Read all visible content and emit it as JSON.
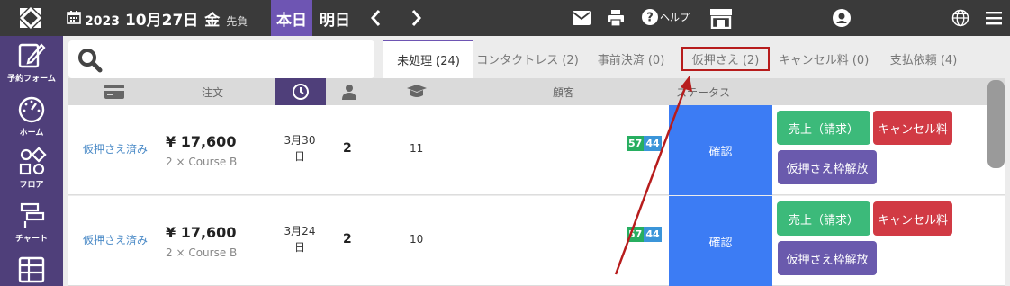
{
  "header": {
    "year": "2023",
    "month_day": "10月27日",
    "weekday": "金",
    "rokuyo": "先負",
    "today_label": "本日",
    "tomorrow_label": "明日",
    "help_label": "ヘルプ",
    "accent_color": "#6e55b3"
  },
  "sidebar": {
    "items": [
      {
        "label": "予約フォーム",
        "icon": "edit-form-icon"
      },
      {
        "label": "ホーム",
        "icon": "dashboard-gauge-icon"
      },
      {
        "label": "フロア",
        "icon": "floor-shapes-icon"
      },
      {
        "label": "チャート",
        "icon": "chart-gantt-icon"
      },
      {
        "label": "",
        "icon": "table-grid-icon"
      }
    ]
  },
  "search": {
    "placeholder": ""
  },
  "tabs": [
    {
      "label": "未処理 (24)",
      "active": true
    },
    {
      "label": "コンタクトレス (2)",
      "active": false
    },
    {
      "label": "事前決済 (0)",
      "active": false
    },
    {
      "label": "仮押さえ (2)",
      "active": false,
      "highlighted": true
    },
    {
      "label": "キャンセル料 (0)",
      "active": false
    },
    {
      "label": "支払依頼 (4)",
      "active": false
    }
  ],
  "table": {
    "headers": {
      "order": "注文",
      "customer": "顧客",
      "status": "ステータス"
    },
    "rows": [
      {
        "status": "仮押さえ済み",
        "price": "¥ 17,600",
        "course": "2 × Course B",
        "date_line1": "3月30",
        "date_line2": "日",
        "people": "2",
        "table": "11",
        "badge1": "57",
        "badge2": "44",
        "confirm": "確認",
        "btn_sales": "売上（請求）",
        "btn_cancel": "キャンセル料",
        "btn_release": "仮押さえ枠解放"
      },
      {
        "status": "仮押さえ済み",
        "price": "¥ 17,600",
        "course": "2 × Course B",
        "date_line1": "3月24",
        "date_line2": "日",
        "people": "2",
        "table": "10",
        "badge1": "57",
        "badge2": "44",
        "confirm": "確認",
        "btn_sales": "売上（請求）",
        "btn_cancel": "キャンセル料",
        "btn_release": "仮押さえ枠解放"
      }
    ]
  },
  "annotation": {
    "arrow_color": "#b71c1c"
  }
}
